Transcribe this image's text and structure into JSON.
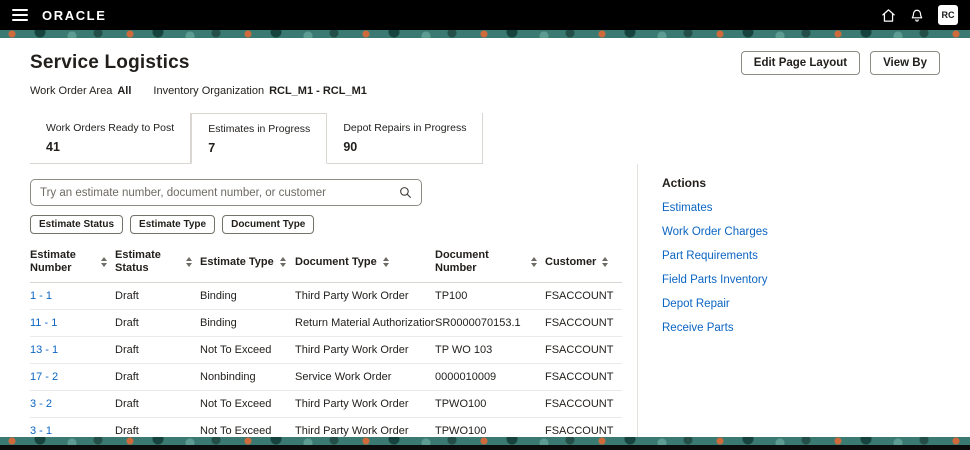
{
  "colors": {
    "link": "#0b65c2",
    "topbar": "#000000",
    "banner": "#3a7a72",
    "border": "#d9d6d1",
    "text": "#211e1b"
  },
  "topbar": {
    "brand": "ORACLE",
    "avatar_initials": "RC"
  },
  "page": {
    "title": "Service Logistics",
    "edit_layout_button": "Edit Page Layout",
    "view_by_button": "View By"
  },
  "context": {
    "area_label": "Work Order Area",
    "area_value": "All",
    "org_label": "Inventory Organization",
    "org_value": "RCL_M1 - RCL_M1"
  },
  "tabs": [
    {
      "label": "Work Orders Ready to Post",
      "count": "41"
    },
    {
      "label": "Estimates in Progress",
      "count": "7"
    },
    {
      "label": "Depot Repairs in Progress",
      "count": "90"
    }
  ],
  "search": {
    "placeholder": "Try an estimate number, document number, or customer"
  },
  "filters": [
    "Estimate Status",
    "Estimate Type",
    "Document Type"
  ],
  "table": {
    "columns": [
      "Estimate Number",
      "Estimate Status",
      "Estimate Type",
      "Document Type",
      "Document Number",
      "Customer"
    ],
    "rows": [
      [
        "1 - 1",
        "Draft",
        "Binding",
        "Third Party Work Order",
        "TP100",
        "FSACCOUNT"
      ],
      [
        "11 - 1",
        "Draft",
        "Binding",
        "Return Material Authorization",
        "SR0000070153.1",
        "FSACCOUNT"
      ],
      [
        "13 - 1",
        "Draft",
        "Not To Exceed",
        "Third Party Work Order",
        "TP WO 103",
        "FSACCOUNT"
      ],
      [
        "17 - 2",
        "Draft",
        "Nonbinding",
        "Service Work Order",
        "0000010009",
        "FSACCOUNT"
      ],
      [
        "3 - 2",
        "Draft",
        "Not To Exceed",
        "Third Party Work Order",
        "TPWO100",
        "FSACCOUNT"
      ],
      [
        "3 - 1",
        "Draft",
        "Not To Exceed",
        "Third Party Work Order",
        "TPWO100",
        "FSACCOUNT"
      ]
    ]
  },
  "actions": {
    "title": "Actions",
    "links": [
      "Estimates",
      "Work Order Charges",
      "Part Requirements",
      "Field Parts Inventory",
      "Depot Repair",
      "Receive Parts"
    ]
  }
}
